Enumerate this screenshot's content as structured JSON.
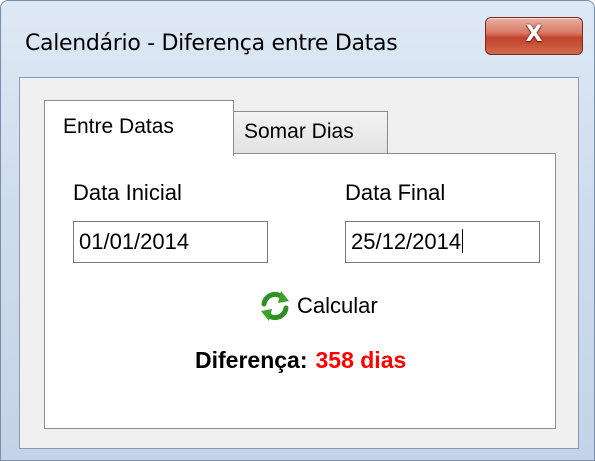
{
  "window": {
    "title": "Calendário - Diferença entre Datas",
    "close_glyph": "X"
  },
  "tabs": [
    {
      "label": "Entre Datas",
      "active": true
    },
    {
      "label": "Somar Dias",
      "active": false
    }
  ],
  "form": {
    "start_label": "Data Inicial",
    "start_value": "01/01/2014",
    "end_label": "Data Final",
    "end_value": "25/12/2014"
  },
  "actions": {
    "calculate_label": "Calcular",
    "calculate_icon": "refresh-icon"
  },
  "result": {
    "label": "Diferença:",
    "value": "358 dias",
    "value_color": "#ff0000"
  },
  "colors": {
    "close_button": "#c3432c",
    "icon_green": "#3aa329"
  }
}
